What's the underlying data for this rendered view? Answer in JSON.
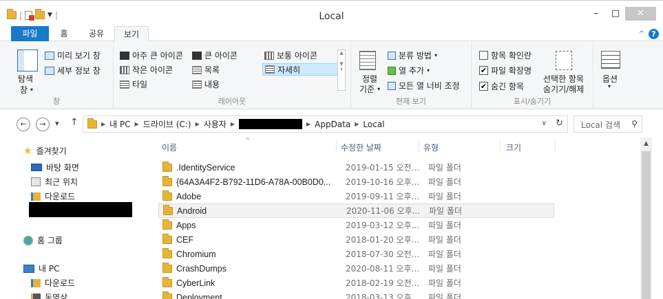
{
  "window": {
    "title": "Local",
    "minimize": "–",
    "maximize": "□",
    "close": "✕"
  },
  "ribbon_tabs": [
    {
      "label": "파일"
    },
    {
      "label": "홈"
    },
    {
      "label": "공유"
    },
    {
      "label": "보기"
    }
  ],
  "ribbon": {
    "panes": {
      "nav_pane_label": "탐색",
      "nav_pane_sub": "창",
      "preview_pane": "미리 보기 창",
      "details_pane": "세부 정보 창",
      "group_label": "창"
    },
    "layout": {
      "extra_large_icons": "아주 큰 아이콘",
      "large_icons": "큰 아이콘",
      "medium_icons": "보통 아이콘",
      "small_icons": "작은 아이콘",
      "list": "목록",
      "details": "자세히",
      "tiles": "타일",
      "content": "내용",
      "group_label": "레이아웃"
    },
    "current_view": {
      "sort_by_1": "정렬",
      "sort_by_2": "기준",
      "group_by": "분류 방법",
      "add_columns": "열 추가",
      "size_all_columns": "모든 열 너비 조정",
      "group_label": "현재 보기"
    },
    "show_hide": {
      "item_checkboxes": "항목 확인란",
      "item_checkboxes_checked": false,
      "file_extensions": "파일 확장명",
      "file_extensions_checked": true,
      "hidden_items": "숨긴 항목",
      "hidden_items_checked": true,
      "hide_selected_1": "선택한 항목",
      "hide_selected_2": "숨기기/해제",
      "group_label": "표시/숨기기"
    },
    "options": {
      "label": "옵션"
    }
  },
  "address_bar": {
    "crumbs": [
      "내 PC",
      "드라이브 (C:)",
      "사용자",
      "AppData",
      "Local"
    ],
    "search_placeholder": "Local 검색"
  },
  "nav_pane": {
    "favorites": "즐겨찾기",
    "desktop": "바탕 화면",
    "recent": "최근 위치",
    "downloads": "다운로드",
    "homegroup": "홈 그룹",
    "this_pc": "내 PC",
    "pc_downloads": "다운로드",
    "pc_videos": "동영상"
  },
  "columns": {
    "name": "이름",
    "date": "수정한 날짜",
    "type": "유형",
    "size": "크기"
  },
  "files": [
    {
      "name": ".IdentityService",
      "date": "2019-01-15 오전...",
      "type": "파일 폴더"
    },
    {
      "name": "{64A3A4F2-B792-11D6-A78A-00B0D0...",
      "date": "2019-10-16 오후...",
      "type": "파일 폴더"
    },
    {
      "name": "Adobe",
      "date": "2019-09-11 오후...",
      "type": "파일 폴더"
    },
    {
      "name": "Android",
      "date": "2020-11-06 오후...",
      "type": "파일 폴더"
    },
    {
      "name": "Apps",
      "date": "2019-03-12 오후...",
      "type": "파일 폴더"
    },
    {
      "name": "CEF",
      "date": "2018-01-20 오후...",
      "type": "파일 폴더"
    },
    {
      "name": "Chromium",
      "date": "2018-07-30 오전...",
      "type": "파일 폴더"
    },
    {
      "name": "CrashDumps",
      "date": "2020-08-11 오후...",
      "type": "파일 폴더"
    },
    {
      "name": "CyberLink",
      "date": "2018-02-19 오전...",
      "type": "파일 폴더"
    },
    {
      "name": "Deployment",
      "date": "2018-03-13 오후...",
      "type": "파일 폴더"
    }
  ],
  "selected_index": 3
}
